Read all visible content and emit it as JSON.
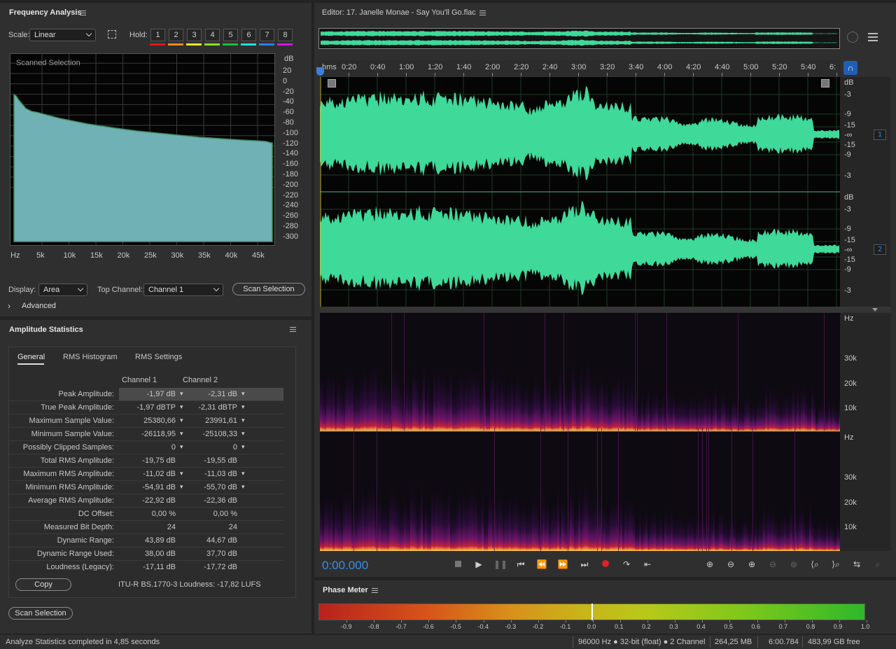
{
  "freq": {
    "title": "Frequency Analysis",
    "scale_label": "Scale:",
    "scale_value": "Linear",
    "hold_label": "Hold:",
    "holds": [
      {
        "label": "1",
        "color": "#e01818"
      },
      {
        "label": "2",
        "color": "#f08a18"
      },
      {
        "label": "3",
        "color": "#f0e818"
      },
      {
        "label": "4",
        "color": "#88e018"
      },
      {
        "label": "5",
        "color": "#18c038"
      },
      {
        "label": "6",
        "color": "#18e0e0"
      },
      {
        "label": "7",
        "color": "#2880f0"
      },
      {
        "label": "8",
        "color": "#d018e0"
      }
    ],
    "graph_label": "Scanned Selection",
    "db_unit": "dB",
    "db_ticks": [
      "20",
      "0",
      "-20",
      "-40",
      "-60",
      "-80",
      "-100",
      "-120",
      "-140",
      "-160",
      "-180",
      "-200",
      "-220",
      "-240",
      "-260",
      "-280",
      "-300"
    ],
    "hz_unit": "Hz",
    "hz_ticks": [
      "5k",
      "10k",
      "15k",
      "20k",
      "25k",
      "30k",
      "35k",
      "40k",
      "45k"
    ],
    "display_label": "Display:",
    "display_value": "Area",
    "top_channel_label": "Top Channel:",
    "top_channel_value": "Channel 1",
    "scan_button": "Scan Selection",
    "advanced_label": "Advanced"
  },
  "amp": {
    "title": "Amplitude Statistics",
    "tabs": [
      "General",
      "RMS Histogram",
      "RMS Settings"
    ],
    "col1": "Channel 1",
    "col2": "Channel 2",
    "rows": [
      {
        "name": "Peak Amplitude:",
        "c1": "-1,97 dB",
        "c2": "-2,31 dB",
        "m": true
      },
      {
        "name": "True Peak Amplitude:",
        "c1": "-1,97 dBTP",
        "c2": "-2,31 dBTP",
        "m": true
      },
      {
        "name": "Maximum Sample Value:",
        "c1": "25380,66",
        "c2": "23991,61",
        "m": true
      },
      {
        "name": "Minimum Sample Value:",
        "c1": "-26118,95",
        "c2": "-25108,33",
        "m": true
      },
      {
        "name": "Possibly Clipped Samples:",
        "c1": "0",
        "c2": "0",
        "m": true
      },
      {
        "name": "Total RMS Amplitude:",
        "c1": "-19,75 dB",
        "c2": "-19,55 dB",
        "m": false
      },
      {
        "name": "Maximum RMS Amplitude:",
        "c1": "-11,02 dB",
        "c2": "-11,03 dB",
        "m": true
      },
      {
        "name": "Minimum RMS Amplitude:",
        "c1": "-54,91 dB",
        "c2": "-55,70 dB",
        "m": true
      },
      {
        "name": "Average RMS Amplitude:",
        "c1": "-22,92 dB",
        "c2": "-22,36 dB",
        "m": false
      },
      {
        "name": "DC Offset:",
        "c1": "0,00 %",
        "c2": "0,00 %",
        "m": false
      },
      {
        "name": "Measured Bit Depth:",
        "c1": "24",
        "c2": "24",
        "m": false
      },
      {
        "name": "Dynamic Range:",
        "c1": "43,89 dB",
        "c2": "44,67 dB",
        "m": false
      },
      {
        "name": "Dynamic Range Used:",
        "c1": "38,00 dB",
        "c2": "37,70 dB",
        "m": false
      },
      {
        "name": "Loudness (Legacy):",
        "c1": "-17,11 dB",
        "c2": "-17,72 dB",
        "m": false
      }
    ],
    "copy_button": "Copy",
    "loudness": "ITU-R BS.1770-3 Loudness: -17,82 LUFS",
    "scan_button": "Scan Selection"
  },
  "editor": {
    "title": "Editor: 17. Janelle Monae - Say You'll Go.flac",
    "time_unit": "hms",
    "time_ticks": [
      "0:20",
      "0:40",
      "1:00",
      "1:20",
      "1:40",
      "2:00",
      "2:20",
      "2:40",
      "3:00",
      "3:20",
      "3:40",
      "4:00",
      "4:20",
      "4:40",
      "5:00",
      "5:20",
      "5:40",
      "6:"
    ],
    "wave_db_labels": [
      "dB",
      "-3",
      "-9",
      "-15",
      "-∞",
      "-15",
      "-9",
      "-3"
    ],
    "channel_badges": [
      "1",
      "2"
    ],
    "spec_labels": [
      "Hz",
      "30k",
      "20k",
      "10k"
    ],
    "time_display": "0:00.000",
    "wave_color": "#3fd99a",
    "accent_color": "#2d8ceb"
  },
  "phase": {
    "title": "Phase Meter",
    "ticks": [
      "-0.9",
      "-0.8",
      "-0.7",
      "-0.6",
      "-0.5",
      "-0.4",
      "-0.3",
      "-0.2",
      "-0.1",
      "0.0",
      "0.1",
      "0.2",
      "0.3",
      "0.4",
      "0.5",
      "0.6",
      "0.7",
      "0.8",
      "0.9",
      "1.0"
    ]
  },
  "status": {
    "message": "Analyze Statistics completed in 4,85 seconds",
    "format": "96000 Hz ● 32-bit (float) ● 2 Channel",
    "size": "264,25 MB",
    "duration": "6:00.784",
    "free": "483,99 GB free"
  }
}
